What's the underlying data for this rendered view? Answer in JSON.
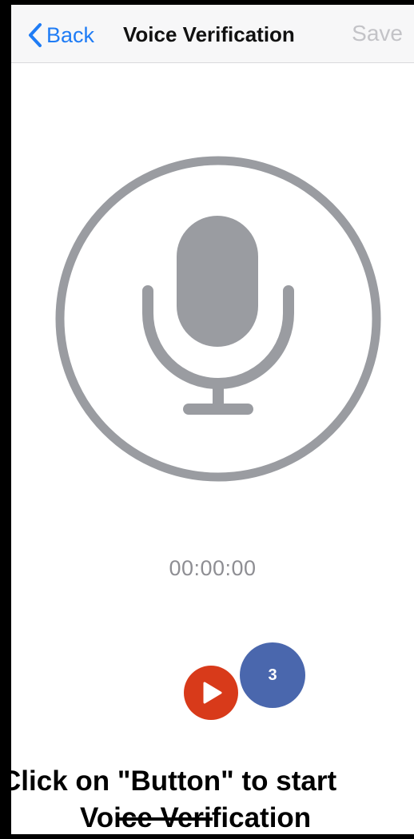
{
  "navbar": {
    "back_label": "Back",
    "title": "Voice Verification",
    "save_label": "Save"
  },
  "recorder": {
    "timer": "00:00:00",
    "badge_count": "3"
  },
  "caption": {
    "line1": "Click on \"Button\" to start",
    "line2": "Voice Verification"
  },
  "colors": {
    "accent_blue": "#1f7cf5",
    "mic_gray": "#9a9ca1",
    "record_red": "#d83a1a",
    "badge_blue": "#4a67ad"
  },
  "icons": {
    "back": "chevron-left-icon",
    "mic": "microphone-icon",
    "play": "play-icon"
  }
}
